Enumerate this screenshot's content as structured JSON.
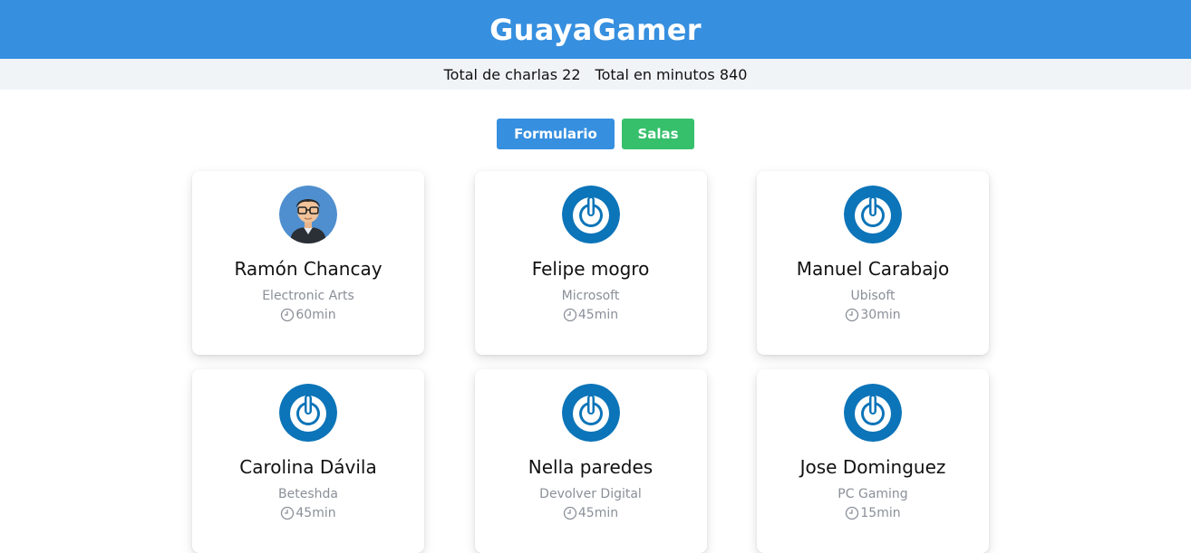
{
  "app": {
    "title": "GuayaGamer"
  },
  "stats": {
    "total_talks_text": "Total de charlas 22",
    "total_minutes_text": "Total en minutos 840"
  },
  "actions": {
    "form_label": "Formulario",
    "rooms_label": "Salas"
  },
  "colors": {
    "header_bg": "#368fdf",
    "stats_bg": "#f1f4f7",
    "form_button": "#368fdf",
    "rooms_button": "#36c06b",
    "muted_text": "#8a8f98"
  },
  "speakers": [
    {
      "name": "Ramón Chancay",
      "company": "Electronic Arts",
      "duration": "60min",
      "avatar": "person-avatar"
    },
    {
      "name": "Felipe mogro",
      "company": "Microsoft",
      "duration": "45min",
      "avatar": "power-logo-avatar"
    },
    {
      "name": "Manuel Carabajo",
      "company": "Ubisoft",
      "duration": "30min",
      "avatar": "power-logo-avatar"
    },
    {
      "name": "Carolina Dávila",
      "company": "Beteshda",
      "duration": "45min",
      "avatar": "power-logo-avatar"
    },
    {
      "name": "Nella paredes",
      "company": "Devolver Digital",
      "duration": "45min",
      "avatar": "power-logo-avatar"
    },
    {
      "name": "Jose Dominguez",
      "company": "PC Gaming",
      "duration": "15min",
      "avatar": "power-logo-avatar"
    }
  ]
}
